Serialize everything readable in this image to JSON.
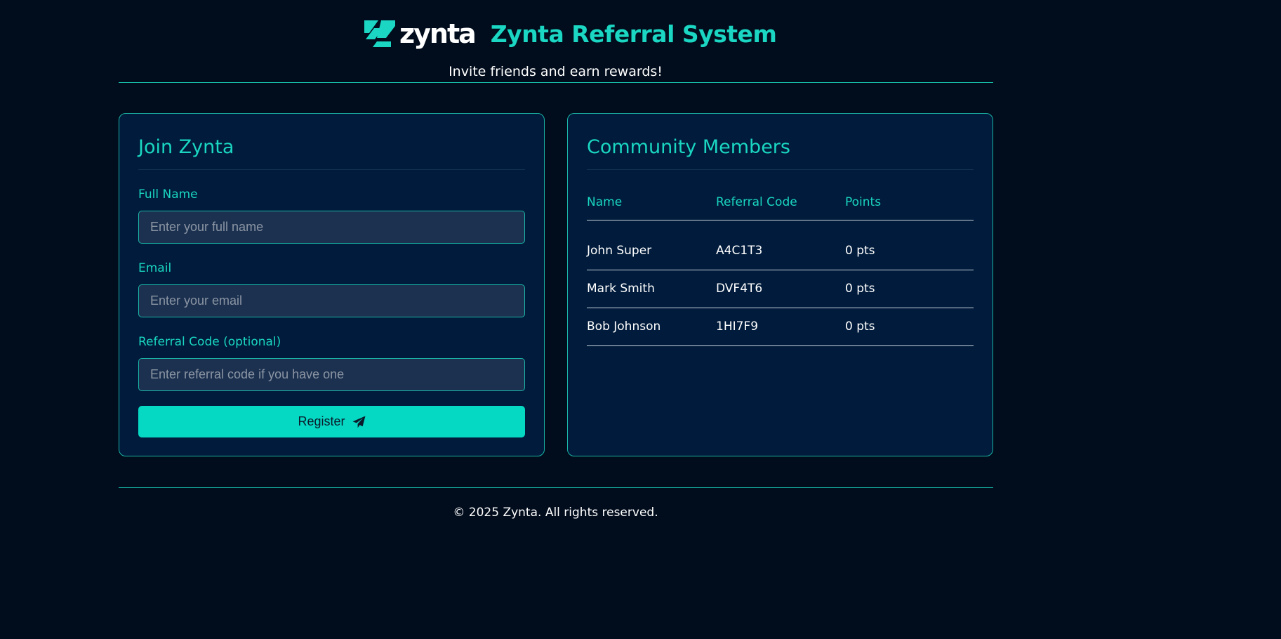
{
  "header": {
    "logo_text": "zynta",
    "title": "Zynta Referral System",
    "tagline": "Invite friends and earn rewards!"
  },
  "join_form": {
    "title": "Join Zynta",
    "full_name_label": "Full Name",
    "full_name_placeholder": "Enter your full name",
    "email_label": "Email",
    "email_placeholder": "Enter your email",
    "referral_label": "Referral Code (optional)",
    "referral_placeholder": "Enter referral code if you have one",
    "register_label": "Register",
    "register_icon": "paper-plane-icon"
  },
  "members": {
    "title": "Community Members",
    "columns": [
      "Name",
      "Referral Code",
      "Points"
    ],
    "rows": [
      {
        "name": "John Super",
        "code": "A4C1T3",
        "points": "0 pts"
      },
      {
        "name": "Mark Smith",
        "code": "DVF4T6",
        "points": "0 pts"
      },
      {
        "name": "Bob Johnson",
        "code": "1HI7F9",
        "points": "0 pts"
      }
    ]
  },
  "footer": {
    "text": "© 2025 Zynta. All rights reserved."
  },
  "colors": {
    "background": "#010c1c",
    "card": "#001b3b",
    "accent": "#1ad6c2",
    "button": "#06d9c3",
    "input": "#1c3150"
  }
}
